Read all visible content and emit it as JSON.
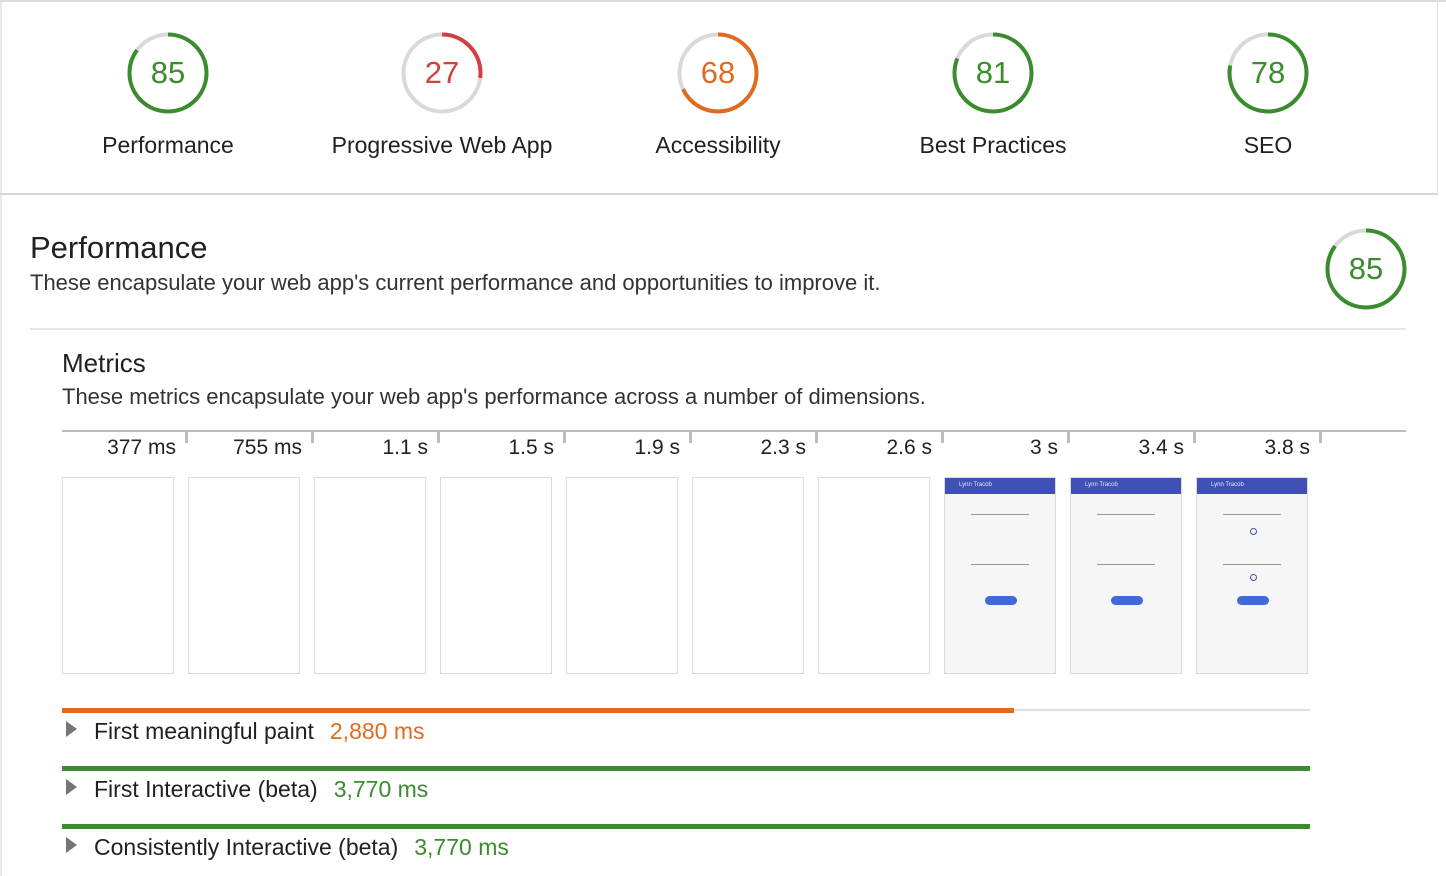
{
  "colors": {
    "pass": "#3a8c2e",
    "average": "#e06b1f",
    "fail": "#d23f3f",
    "track": "#d9d9d9"
  },
  "summary": [
    {
      "score": "85",
      "fraction": 0.85,
      "label": "Performance",
      "color": "#3a8c2e"
    },
    {
      "score": "27",
      "fraction": 0.27,
      "label": "Progressive Web App",
      "color": "#d23f3f"
    },
    {
      "score": "68",
      "fraction": 0.68,
      "label": "Accessibility",
      "color": "#e06b1f"
    },
    {
      "score": "81",
      "fraction": 0.81,
      "label": "Best Practices",
      "color": "#3a8c2e"
    },
    {
      "score": "78",
      "fraction": 0.78,
      "label": "SEO",
      "color": "#3a8c2e"
    }
  ],
  "performance": {
    "title": "Performance",
    "description": "These encapsulate your web app's current performance and opportunities to improve it.",
    "score": "85",
    "fraction": 0.85
  },
  "metrics": {
    "title": "Metrics",
    "description": "These metrics encapsulate your web app's performance across a number of dimensions.",
    "ticks": [
      "377 ms",
      "755 ms",
      "1.1 s",
      "1.5 s",
      "1.9 s",
      "2.3 s",
      "2.6 s",
      "3 s",
      "3.4 s",
      "3.8 s"
    ],
    "filmstrip_app_title": "Lynn Tracob",
    "items": [
      {
        "name": "First meaningful paint",
        "value": "2,880 ms",
        "color": "#e06b1f",
        "progress": 0.763
      },
      {
        "name": "First Interactive (beta)",
        "value": "3,770 ms",
        "color": "#3a8c2e",
        "progress": 1.0
      },
      {
        "name": "Consistently Interactive (beta)",
        "value": "3,770 ms",
        "color": "#3a8c2e",
        "progress": 1.0
      }
    ]
  }
}
